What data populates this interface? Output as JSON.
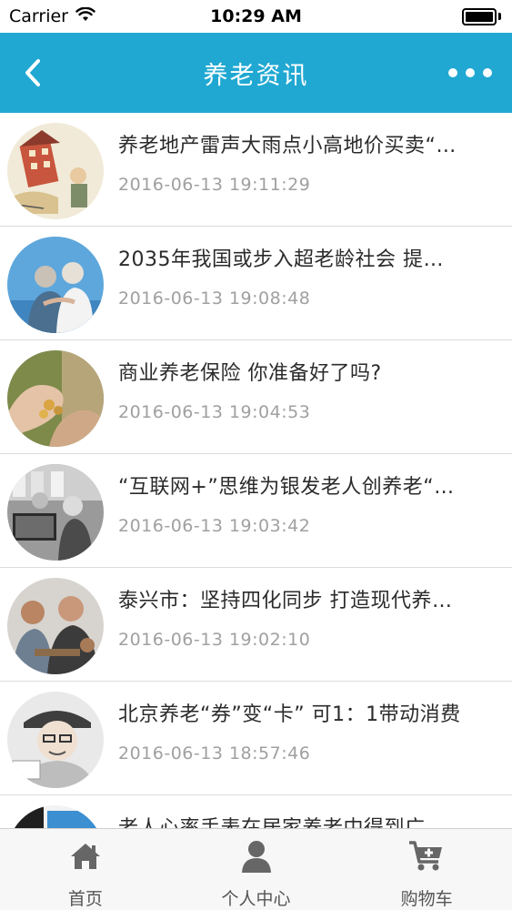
{
  "status_bar": {
    "carrier": "Carrier",
    "time": "10:29 AM"
  },
  "nav": {
    "title": "养老资讯",
    "back_icon": "chevron-left-icon",
    "more_icon": "more-dots-icon"
  },
  "news": [
    {
      "title": "养老地产雷声大雨点小高地价买卖“…",
      "time": "2016-06-13 19:11:29"
    },
    {
      "title": "2035年我国或步入超老龄社会 提…",
      "time": "2016-06-13 19:08:48"
    },
    {
      "title": "商业养老保险 你准备好了吗?",
      "time": "2016-06-13 19:04:53"
    },
    {
      "title": "“互联网+”思维为银发老人创养老“…",
      "time": "2016-06-13 19:03:42"
    },
    {
      "title": "泰兴市：坚持四化同步 打造现代养…",
      "time": "2016-06-13 19:02:10"
    },
    {
      "title": "北京养老“券”变“卡” 可1：1带动消费",
      "time": "2016-06-13 18:57:46"
    },
    {
      "title": "老人心率手表在居家养老中得到广…",
      "time": ""
    }
  ],
  "tabs": [
    {
      "label": "首页",
      "icon": "home-icon"
    },
    {
      "label": "个人中心",
      "icon": "person-icon"
    },
    {
      "label": "购物车",
      "icon": "cart-icon"
    }
  ],
  "colors": {
    "nav_bg": "#20a8d2",
    "time_text": "#a0a0a0",
    "tab_icon": "#666666"
  }
}
